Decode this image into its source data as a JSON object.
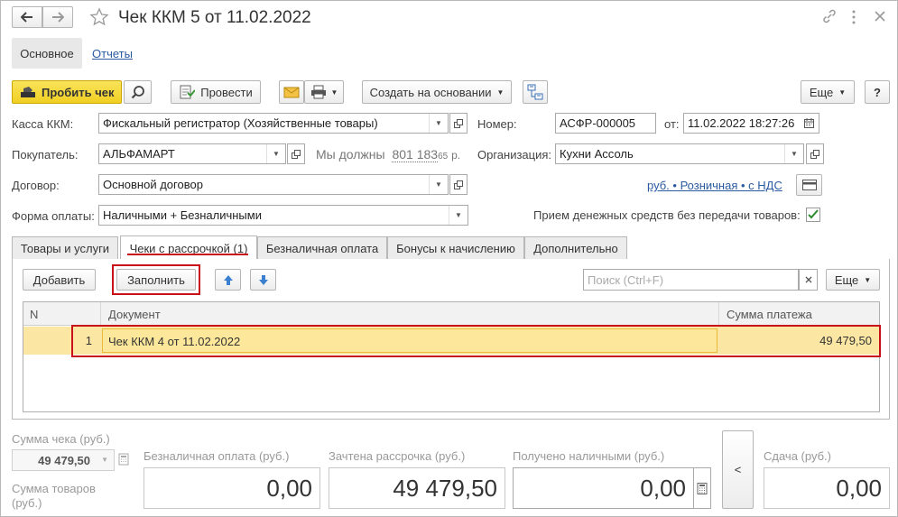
{
  "window": {
    "title": "Чек ККМ 5 от 11.02.2022"
  },
  "top_tabs": [
    {
      "label": "Основное"
    },
    {
      "label": "Отчеты"
    }
  ],
  "toolbar": {
    "print_check_label": "Пробить чек",
    "post_label": "Провести",
    "create_based_label": "Создать на основании",
    "more_label": "Еще",
    "help_label": "?"
  },
  "form": {
    "kassa_label": "Касса ККМ:",
    "kassa_value": "Фискальный регистратор (Хозяйственные товары)",
    "number_label": "Номер:",
    "number_value": "АСФР-000005",
    "date_label": "от:",
    "date_value": "11.02.2022 18:27:26",
    "buyer_label": "Покупатель:",
    "buyer_value": "АЛЬФАМАРТ",
    "debt_prefix": "Мы должны",
    "debt_amount": "801 183",
    "debt_kop": "65",
    "debt_currency": "р.",
    "org_label": "Организация:",
    "org_value": "Кухни Ассоль",
    "contract_label": "Договор:",
    "contract_value": "Основной договор",
    "price_link": "руб. • Розничная • с НДС",
    "payment_label": "Форма оплаты:",
    "payment_value": "Наличными + Безналичными",
    "receipt_label": "Прием денежных средств без передачи товаров:"
  },
  "tabs": [
    {
      "label": "Товары и услуги"
    },
    {
      "label": "Чеки с рассрочкой (1)"
    },
    {
      "label": "Безналичная оплата"
    },
    {
      "label": "Бонусы к начислению"
    },
    {
      "label": "Дополнительно"
    }
  ],
  "table_toolbar": {
    "add_label": "Добавить",
    "fill_label": "Заполнить",
    "search_placeholder": "Поиск (Ctrl+F)",
    "more_label": "Еще"
  },
  "table": {
    "columns": [
      "N",
      "Документ",
      "Сумма платежа"
    ],
    "rows": [
      {
        "n": "1",
        "document": "Чек ККМ 4 от 11.02.2022",
        "amount": "49 479,50"
      }
    ]
  },
  "totals": {
    "check_sum_label": "Сумма чека (руб.)",
    "check_sum_value": "49 479,50",
    "goods_sum_label": "Сумма товаров (руб.)",
    "cashless_label": "Безналичная оплата (руб.)",
    "cashless_value": "0,00",
    "installment_label": "Зачтена рассрочка (руб.)",
    "installment_value": "49 479,50",
    "cash_label": "Получено наличными (руб.)",
    "cash_value": "0,00",
    "collapse_label": "<",
    "change_label": "Сдача (руб.)",
    "change_value": "0,00"
  },
  "colors": {
    "accent_yellow": "#f5d634",
    "highlight_red": "#c8101a",
    "selected_row": "#fbe6a3",
    "link": "#2a5aa0"
  }
}
